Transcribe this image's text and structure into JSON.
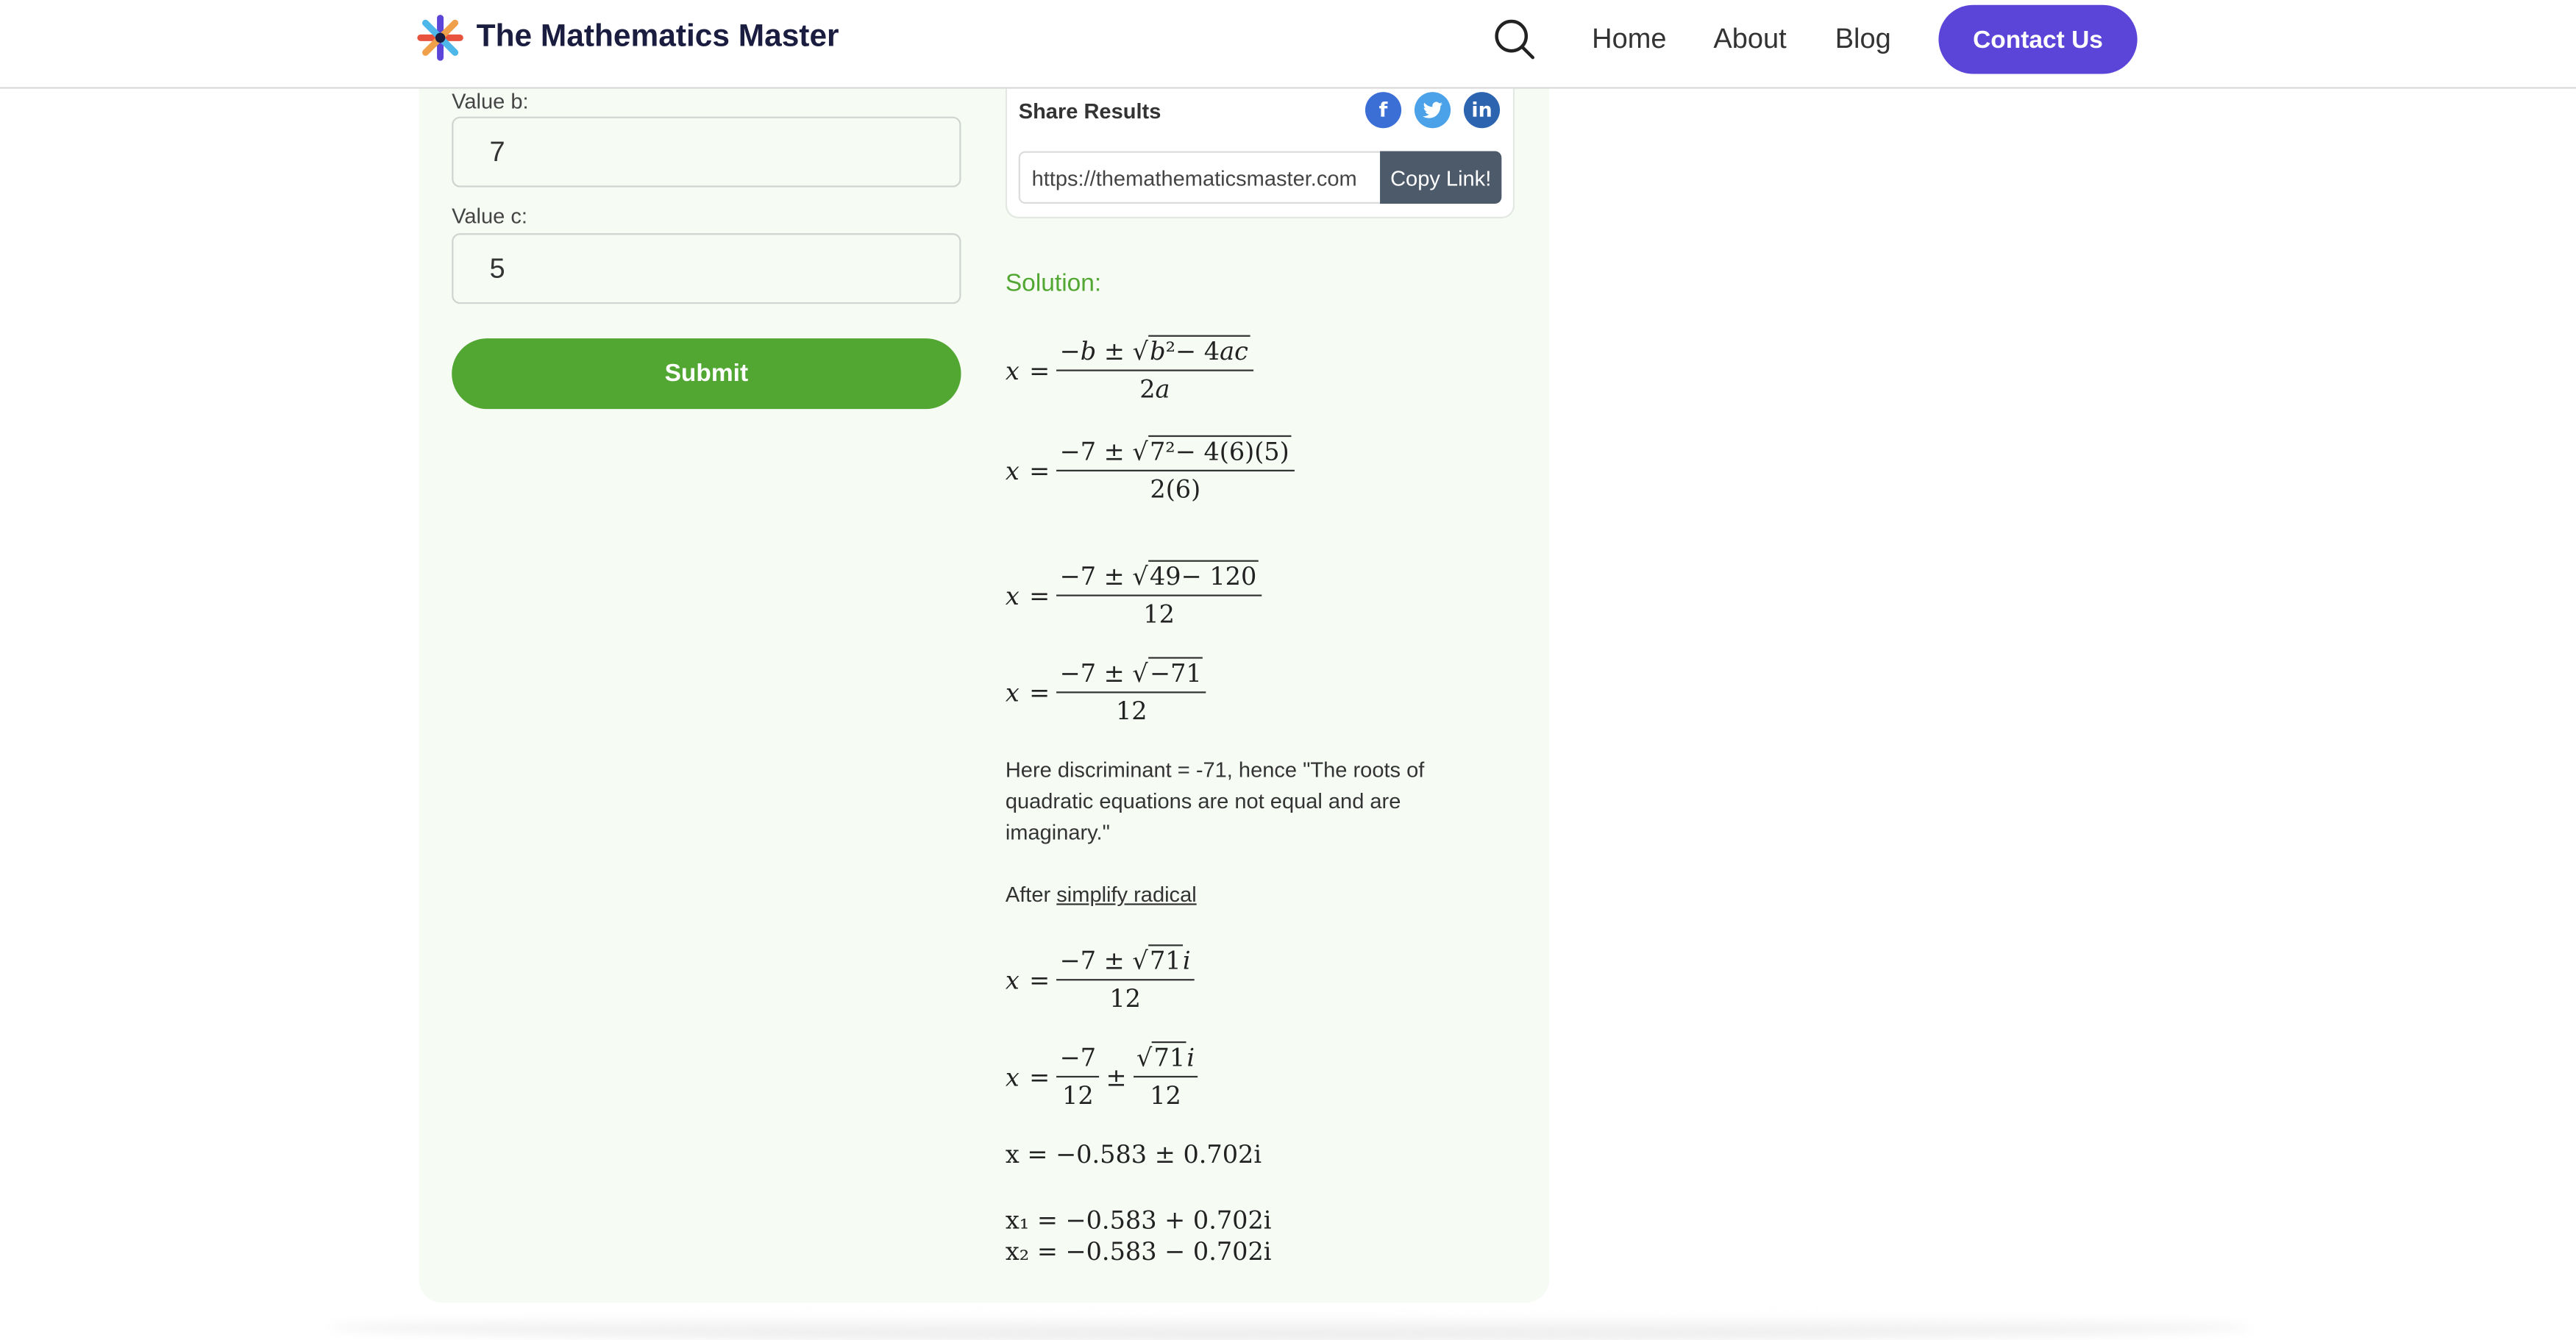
{
  "header": {
    "brand": "The Mathematics Master",
    "nav": [
      "Home",
      "About",
      "Blog"
    ],
    "contact_label": "Contact Us",
    "icons": {
      "search": "search-icon",
      "logo": "asterisk-logo"
    },
    "accent_color": "#5b45d8"
  },
  "form": {
    "b_label": "Value b:",
    "b_value": "7",
    "c_label": "Value c:",
    "c_value": "5",
    "submit_label": "Submit",
    "submit_color": "#52a632"
  },
  "share": {
    "title": "Share Results",
    "url": "https://themathematicsmaster.com",
    "copy_label": "Copy Link!",
    "icons": [
      "facebook-icon",
      "twitter-icon",
      "linkedin-icon"
    ]
  },
  "solution": {
    "title": "Solution:",
    "discriminant_text": "Here discriminant = -71, hence \"The roots of quadratic equations are not equal and are imaginary.\"",
    "after_text": "After",
    "after_link": "simplify radical",
    "decimal_result": "x = −0.583 ± 0.702i",
    "root1": "x₁ = −0.583 + 0.702i",
    "root2": "x₂ = −0.583 − 0.702i"
  }
}
